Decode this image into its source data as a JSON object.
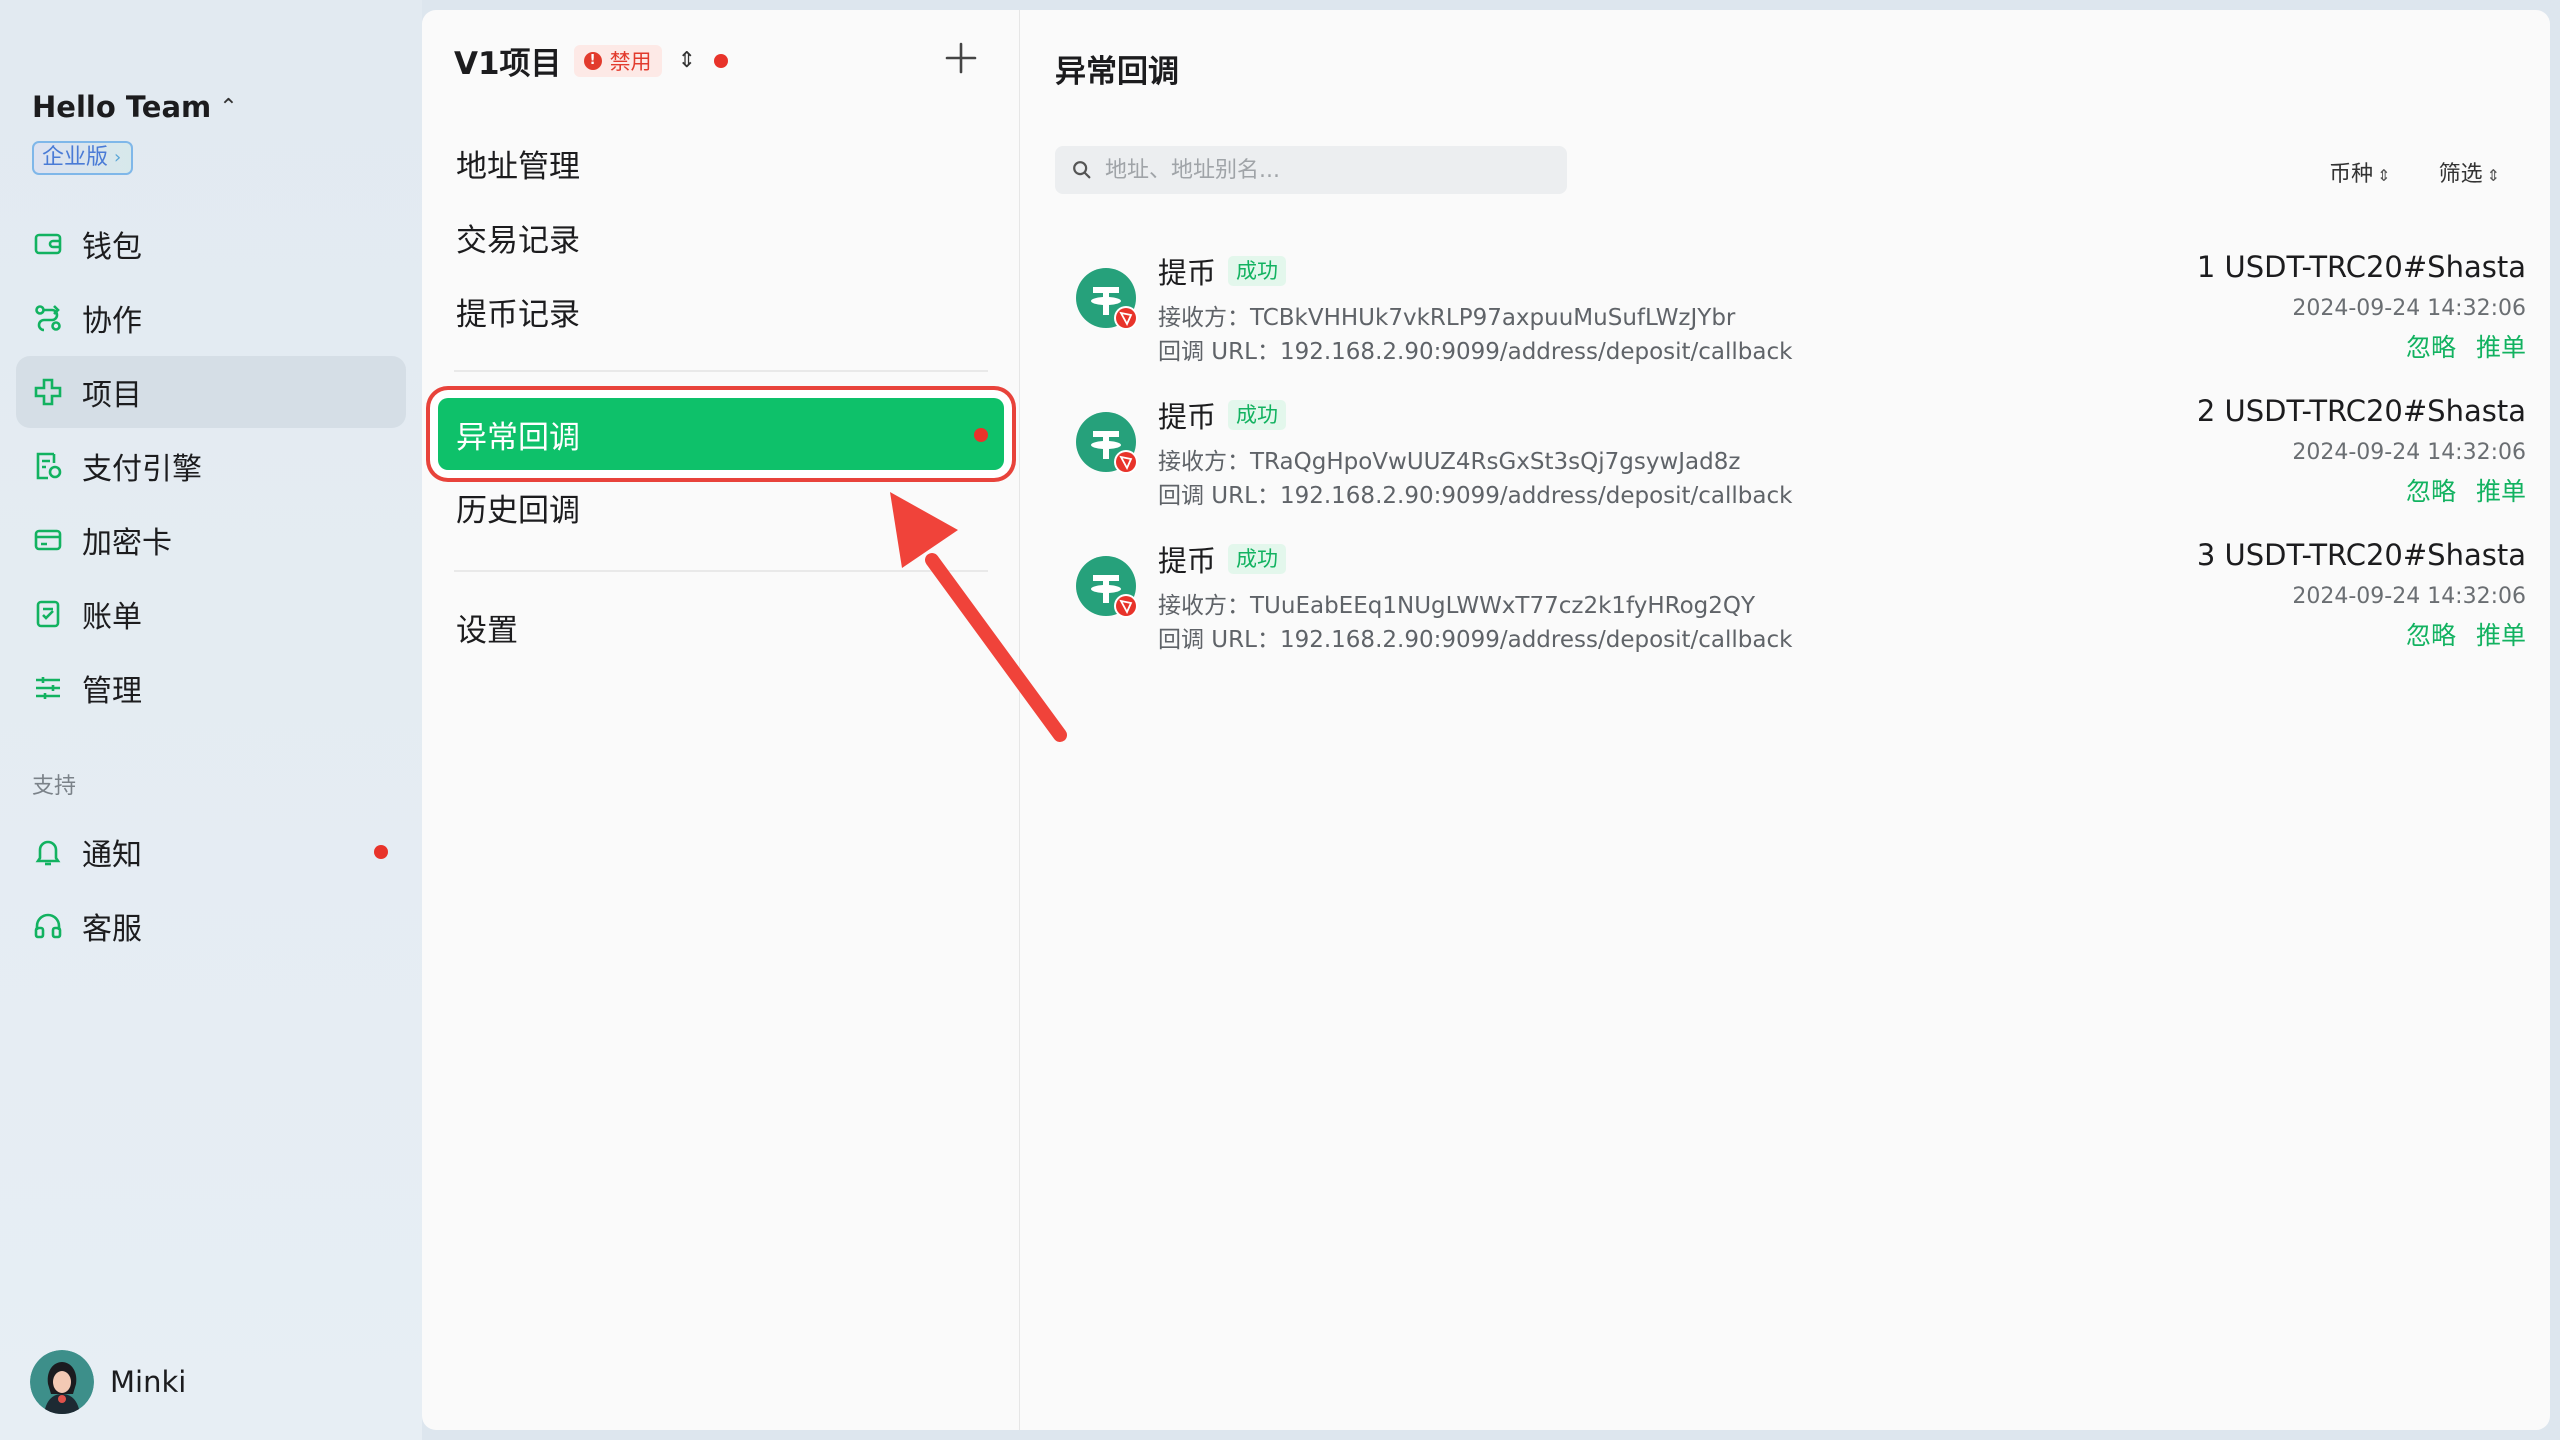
{
  "sidebar": {
    "team_name": "Hello Team",
    "tier": "企业版",
    "nav": [
      {
        "label": "钱包",
        "icon": "wallet-icon"
      },
      {
        "label": "协作",
        "icon": "collab-icon"
      },
      {
        "label": "项目",
        "icon": "project-icon",
        "active": true
      },
      {
        "label": "支付引擎",
        "icon": "payment-engine-icon"
      },
      {
        "label": "加密卡",
        "icon": "card-icon"
      },
      {
        "label": "账单",
        "icon": "bill-icon"
      },
      {
        "label": "管理",
        "icon": "settings-sliders-icon"
      }
    ],
    "support_label": "支持",
    "support": [
      {
        "label": "通知",
        "icon": "bell-icon",
        "has_dot": true
      },
      {
        "label": "客服",
        "icon": "headset-icon"
      }
    ],
    "user": "Minki"
  },
  "project": {
    "name": "V1项目",
    "status_badge": "禁用",
    "menu": [
      {
        "label": "地址管理"
      },
      {
        "label": "交易记录"
      },
      {
        "label": "提币记录"
      },
      {
        "label": "异常回调",
        "selected": true,
        "has_dot": true
      },
      {
        "label": "历史回调"
      },
      {
        "label": "设置"
      }
    ]
  },
  "main": {
    "title": "异常回调",
    "search_placeholder": "地址、地址别名...",
    "filter_coin": "币种",
    "filter_all": "筛选",
    "receiver_key": "接收方：",
    "callback_key": "回调 URL：",
    "records": [
      {
        "type": "提币",
        "status": "成功",
        "receiver": "TCBkVHHUk7vkRLP97axpuuMuSufLWzJYbr",
        "callback": "192.168.2.90:9099/address/deposit/callback",
        "amount": "1 USDT-TRC20#Shasta",
        "time": "2024-09-24 14:32:06",
        "ignore": "忽略",
        "push": "推单"
      },
      {
        "type": "提币",
        "status": "成功",
        "receiver": "TRaQgHpoVwUUZ4RsGxSt3sQj7gsywJad8z",
        "callback": "192.168.2.90:9099/address/deposit/callback",
        "amount": "2 USDT-TRC20#Shasta",
        "time": "2024-09-24 14:32:06",
        "ignore": "忽略",
        "push": "推单"
      },
      {
        "type": "提币",
        "status": "成功",
        "receiver": "TUuEabEEq1NUgLWWxT77cz2k1fyHRog2QY",
        "callback": "192.168.2.90:9099/address/deposit/callback",
        "amount": "3 USDT-TRC20#Shasta",
        "time": "2024-09-24 14:32:06",
        "ignore": "忽略",
        "push": "推单"
      }
    ]
  },
  "colors": {
    "accent_green": "#0ec16a",
    "alert_red": "#e8332a",
    "tether_teal": "#26a17b"
  }
}
